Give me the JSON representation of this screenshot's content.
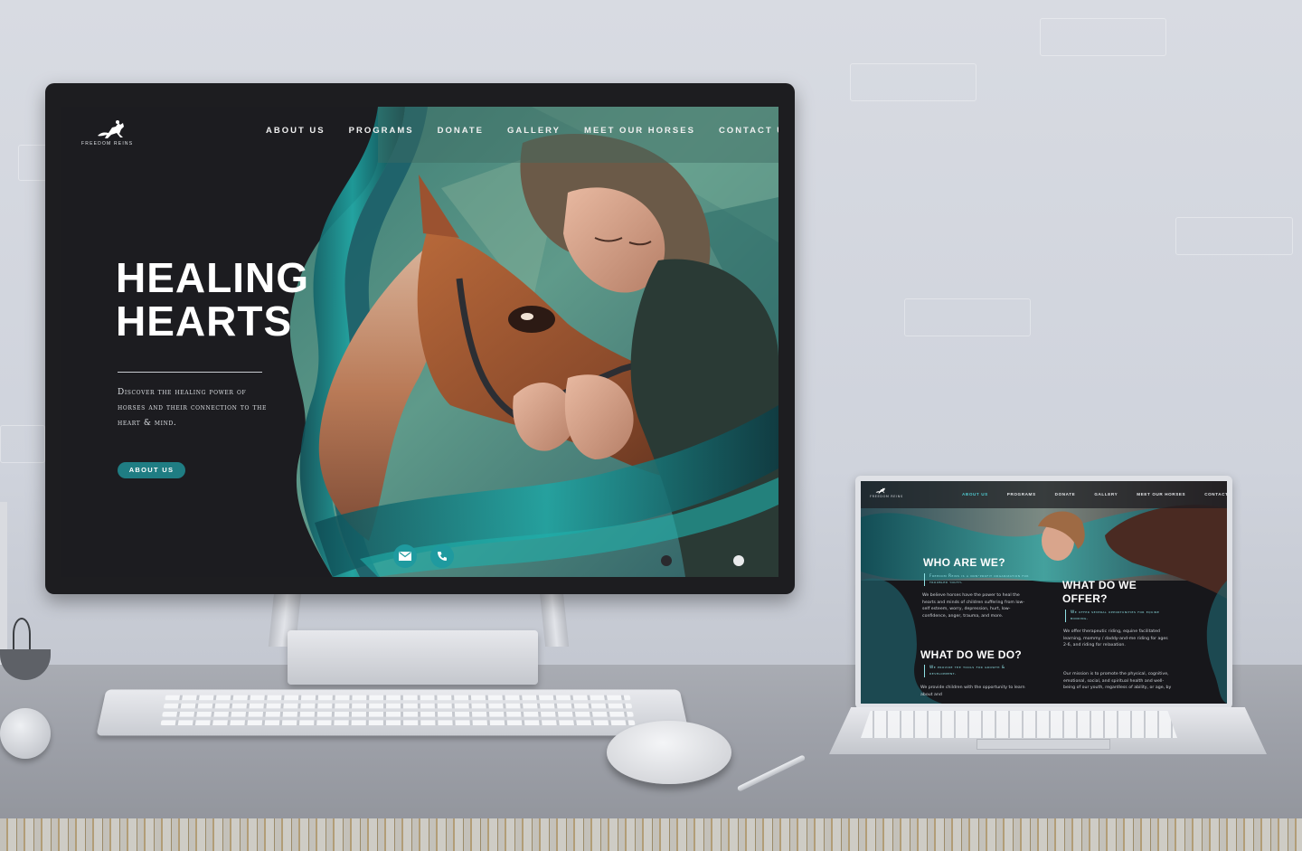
{
  "site": {
    "brand": "FREEDOM REINS",
    "nav": [
      "ABOUT US",
      "PROGRAMS",
      "DONATE",
      "GALLERY",
      "MEET OUR HORSES",
      "CONTACT US"
    ]
  },
  "desktop": {
    "hero_title_1": "HEALING",
    "hero_title_2": "HEARTS",
    "hero_desc": "Discover the healing power of horses and their connection to the heart & mind.",
    "cta": "ABOUT US",
    "contact_icons": [
      "mail-icon",
      "phone-icon"
    ]
  },
  "laptop": {
    "brand": "FREEDOM REINS",
    "active_nav": "ABOUT US",
    "who_heading": "WHO ARE WE?",
    "who_quote": "Freedom Reins is a non-profit organization for troubled youth.",
    "who_body": "We believe horses have the power to heal the hearts and minds of children suffering from low-self esteem, worry, depression, hurt, low- confidence, anger, trauma, and more.",
    "do_heading": "WHAT DO WE DO?",
    "do_quote": "We provide the tools for growth & development.",
    "do_body": "We provide children with the opportunity to learn about and",
    "offer_heading_1": "WHAT DO WE",
    "offer_heading_2": "OFFER?",
    "offer_quote": "We offer several opportunities for equine bonding.",
    "offer_body": "We offer therapeutic riding, equine facilitated learning, mommy / daddy-and-me riding for ages 2-6, and riding for relaxation.",
    "mission_body": "Our mission is to promote the physical, cognitive, emotional, social, and spiritual health and well-being of our youth, regardless of ability, or age, by"
  },
  "colors": {
    "accent": "#1f7d83",
    "teal": "#1f9a9f",
    "dark": "#1a1a1d"
  }
}
